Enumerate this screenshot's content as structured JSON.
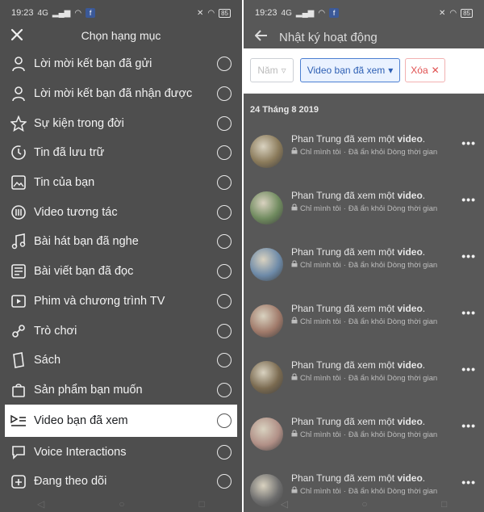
{
  "status_bar": {
    "time": "19:23",
    "network": "4G",
    "battery": "85"
  },
  "left_panel": {
    "title": "Chọn hạng mục",
    "close_icon": "close-icon",
    "categories": [
      {
        "label": "Lời mời kết bạn đã gửi",
        "icon": "person-icon",
        "selected": false
      },
      {
        "label": "Lời mời kết bạn đã nhận được",
        "icon": "person-icon",
        "selected": false
      },
      {
        "label": "Sự kiện trong đời",
        "icon": "star-icon",
        "selected": false
      },
      {
        "label": "Tin đã lưu trữ",
        "icon": "clock-icon",
        "selected": false
      },
      {
        "label": "Tin của bạn",
        "icon": "photo-icon",
        "selected": false
      },
      {
        "label": "Video tương tác",
        "icon": "video-interact-icon",
        "selected": false
      },
      {
        "label": "Bài hát bạn đã nghe",
        "icon": "music-icon",
        "selected": false
      },
      {
        "label": "Bài viết bạn đã đọc",
        "icon": "article-icon",
        "selected": false
      },
      {
        "label": "Phim và chương trình TV",
        "icon": "film-icon",
        "selected": false
      },
      {
        "label": "Trò chơi",
        "icon": "game-icon",
        "selected": false
      },
      {
        "label": "Sách",
        "icon": "book-icon",
        "selected": false
      },
      {
        "label": "Sản phẩm bạn muốn",
        "icon": "bag-icon",
        "selected": false
      },
      {
        "label": "Video bạn đã xem",
        "icon": "video-list-icon",
        "selected": true
      },
      {
        "label": "Voice Interactions",
        "icon": "speech-bubble-icon",
        "selected": false
      },
      {
        "label": "Đang theo dõi",
        "icon": "follow-icon",
        "selected": false
      }
    ]
  },
  "right_panel": {
    "title": "Nhật ký hoạt động",
    "filters": {
      "year": "Năm",
      "type": "Video bạn đã xem",
      "clear": "Xóa"
    },
    "date": "24 Tháng 8 2019",
    "activities": [
      {
        "name": "Phan Trung",
        "action": "đã xem một",
        "object": "video",
        "privacy": "Chỉ mình tôi",
        "status": "Đã ẩn khỏi Dòng thời gian",
        "avatar_color": "#8a7a5a"
      },
      {
        "name": "Phan Trung",
        "action": "đã xem một",
        "object": "video",
        "privacy": "Chỉ mình tôi",
        "status": "Đã ẩn khỏi Dòng thời gian",
        "avatar_color": "#6f8a5e"
      },
      {
        "name": "Phan Trung",
        "action": "đã xem một",
        "object": "video",
        "privacy": "Chỉ mình tôi",
        "status": "Đã ẩn khỏi Dòng thời gian",
        "avatar_color": "#6d8aa8"
      },
      {
        "name": "Phan Trung",
        "action": "đã xem một",
        "object": "video",
        "privacy": "Chỉ mình tôi",
        "status": "Đã ẩn khỏi Dòng thời gian",
        "avatar_color": "#a07a6a"
      },
      {
        "name": "Phan Trung",
        "action": "đã xem một",
        "object": "video",
        "privacy": "Chỉ mình tôi",
        "status": "Đã ẩn khỏi Dòng thời gian",
        "avatar_color": "#7a6a50"
      },
      {
        "name": "Phan Trung",
        "action": "đã xem một",
        "object": "video",
        "privacy": "Chỉ mình tôi",
        "status": "Đã ẩn khỏi Dòng thời gian",
        "avatar_color": "#b08f86"
      },
      {
        "name": "Phan Trung",
        "action": "đã xem một",
        "object": "video",
        "privacy": "Chỉ mình tôi",
        "status": "Đã ẩn khỏi Dòng thời gian",
        "avatar_color": "#6e6e6e"
      }
    ]
  },
  "colors": {
    "overlay_dark": "#4e4e4e",
    "selected_bg": "#ffffff",
    "filter_active": "#2d5fb4",
    "clear_red": "#e05050"
  }
}
